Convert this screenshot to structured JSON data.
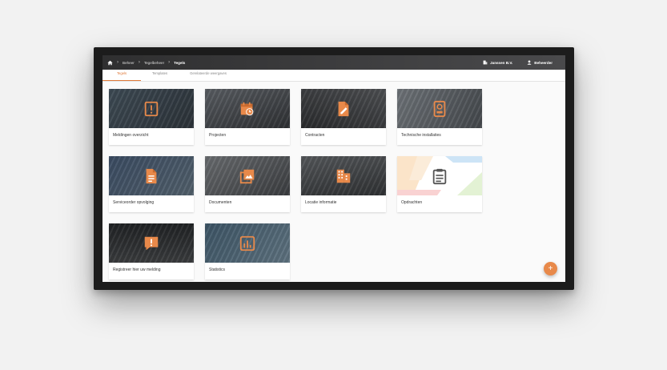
{
  "breadcrumb": {
    "items": [
      "Beheer",
      "Tegelbeheer",
      "Tegels"
    ]
  },
  "topbar": {
    "company": "Janssen B.V.",
    "user": "Beheerder"
  },
  "tabs": [
    {
      "label": "Tegels",
      "active": true
    },
    {
      "label": "Templates",
      "active": false
    },
    {
      "label": "Gerelateerde weergaves",
      "active": false
    }
  ],
  "tiles": [
    {
      "label": "Meldingen overzicht",
      "icon": "alert-box-icon"
    },
    {
      "label": "Projecten",
      "icon": "calendar-clock-icon"
    },
    {
      "label": "Contracten",
      "icon": "document-edit-icon"
    },
    {
      "label": "Technische installaties",
      "icon": "device-icon"
    },
    {
      "label": "Serviceorder opvolging",
      "icon": "document-lines-icon"
    },
    {
      "label": "Documenten",
      "icon": "image-stack-icon"
    },
    {
      "label": "Locatie informatie",
      "icon": "building-icon"
    },
    {
      "label": "Opdrachten",
      "icon": "clipboard-icon"
    },
    {
      "label": "Registreer hier uw melding",
      "icon": "alert-chat-icon"
    },
    {
      "label": "Statistics",
      "icon": "bar-chart-icon"
    }
  ],
  "fab_label": "+",
  "colors": {
    "accent": "#e07a3a",
    "topbar": "#3a3a3c"
  }
}
